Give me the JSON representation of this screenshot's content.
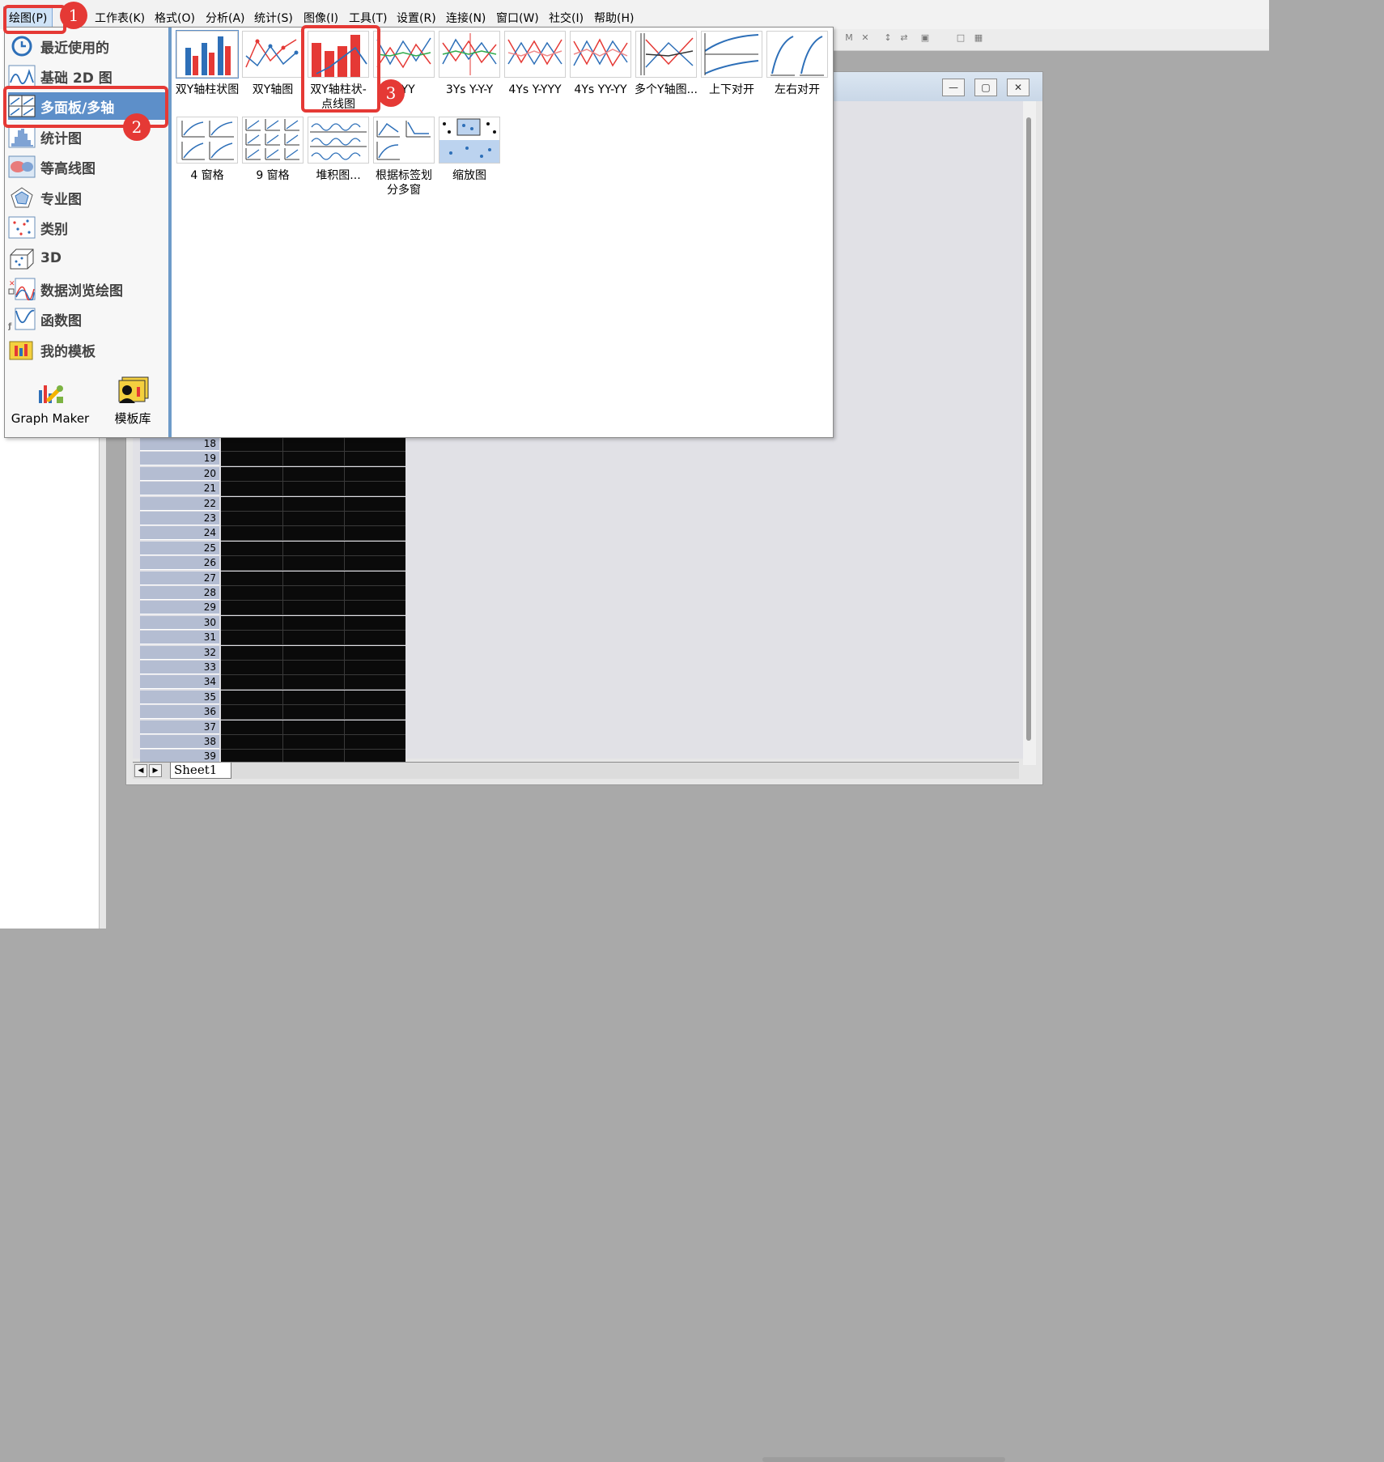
{
  "menubar": {
    "items": [
      "绘图(P)",
      "工作表(K)",
      "格式(O)",
      "分析(A)",
      "统计(S)",
      "图像(I)",
      "工具(T)",
      "设置(R)",
      "连接(N)",
      "窗口(W)",
      "社交(I)",
      "帮助(H)"
    ]
  },
  "categories": [
    {
      "label": "最近使用的",
      "icon": "recent-icon"
    },
    {
      "label": "基础 2D 图",
      "icon": "line-2d-icon"
    },
    {
      "label": "多面板/多轴",
      "icon": "multipanel-icon"
    },
    {
      "label": "统计图",
      "icon": "histogram-icon"
    },
    {
      "label": "等高线图",
      "icon": "contour-icon"
    },
    {
      "label": "专业图",
      "icon": "radar-icon"
    },
    {
      "label": "类别",
      "icon": "category-icon"
    },
    {
      "label": "3D",
      "icon": "3d-icon"
    },
    {
      "label": "数据浏览绘图",
      "icon": "data-explore-icon"
    },
    {
      "label": "函数图",
      "icon": "function-icon"
    },
    {
      "label": "我的模板",
      "icon": "my-template-icon"
    }
  ],
  "selected_category": "多面板/多轴",
  "gallery": {
    "row1": [
      "双Y轴柱状图",
      "双Y轴图",
      "双Y轴柱状-点线图",
      "Y-YY",
      "3Ys Y-Y-Y",
      "4Ys Y-YYY",
      "4Ys YY-YY",
      "多个Y轴图...",
      "上下对开",
      "左右对开"
    ],
    "row2": [
      "4 窗格",
      "9 窗格",
      "堆积图...",
      "根据标签划分多窗",
      "缩放图"
    ]
  },
  "bottom_tools": [
    "Graph Maker",
    "模板库"
  ],
  "worksheet": {
    "row_numbers": [
      "18",
      "19",
      "20",
      "21",
      "22",
      "23",
      "24",
      "25",
      "26",
      "27",
      "28",
      "29",
      "30",
      "31",
      "32",
      "33",
      "34",
      "35",
      "36",
      "37",
      "38",
      "39"
    ],
    "sheet_tab": "Sheet1"
  },
  "annotations": [
    "1",
    "2",
    "3"
  ],
  "colors": {
    "highlight": "#e53935",
    "selection": "#5d8fc9"
  }
}
